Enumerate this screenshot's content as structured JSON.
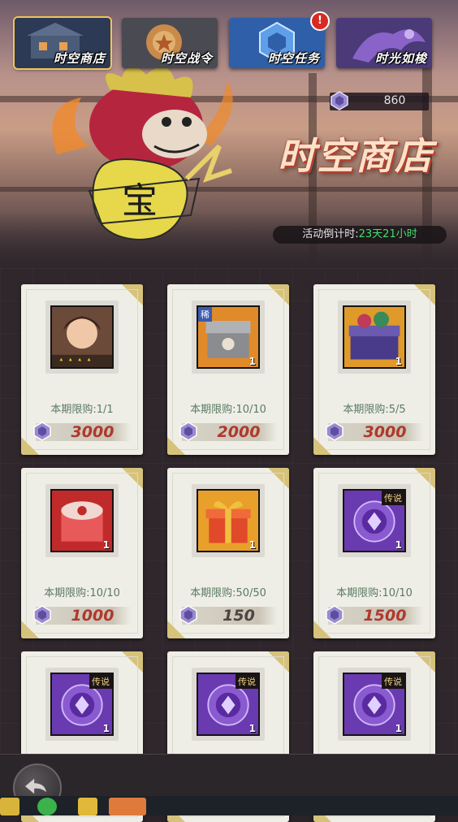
{
  "tabs": [
    {
      "label": "时空商店",
      "active": true
    },
    {
      "label": "时空战令",
      "active": false
    },
    {
      "label": "时空任务",
      "active": false,
      "badge": "!"
    },
    {
      "label": "时光如梭",
      "active": false
    }
  ],
  "currency": {
    "icon": "crystal-gem-icon",
    "value": "860"
  },
  "shop_title": "时空商店",
  "countdown": {
    "label": "活动倒计时:",
    "time": "23天21小时"
  },
  "items": [
    {
      "icon": "hero-portrait-icon",
      "qty": "",
      "tag": "",
      "limit": "本期限购:1/1",
      "price": "3000",
      "price_color": "#b0382c"
    },
    {
      "icon": "rare-chest-icon",
      "qty": "1",
      "tag": "",
      "limit": "本期限购:10/10",
      "price": "2000",
      "price_color": "#b0382c"
    },
    {
      "icon": "treasure-chest-icon",
      "qty": "1",
      "tag": "",
      "limit": "本期限购:5/5",
      "price": "3000",
      "price_color": "#b0382c"
    },
    {
      "icon": "red-box-icon",
      "qty": "1",
      "tag": "",
      "limit": "本期限购:10/10",
      "price": "1000",
      "price_color": "#b0382c"
    },
    {
      "icon": "gift-box-icon",
      "qty": "1",
      "tag": "",
      "limit": "本期限购:50/50",
      "price": "150",
      "price_color": "#4a4640"
    },
    {
      "icon": "legend-emblem-icon",
      "qty": "1",
      "tag": "传说",
      "limit": "本期限购:10/10",
      "price": "1500",
      "price_color": "#b0382c"
    },
    {
      "icon": "legend-emblem-icon",
      "qty": "1",
      "tag": "传说",
      "limit": "",
      "price": "",
      "price_color": "#b0382c"
    },
    {
      "icon": "legend-emblem-icon",
      "qty": "1",
      "tag": "传说",
      "limit": "",
      "price": "",
      "price_color": "#b0382c"
    },
    {
      "icon": "legend-emblem-icon",
      "qty": "1",
      "tag": "传说",
      "limit": "",
      "price": "",
      "price_color": "#b0382c"
    }
  ],
  "rare_tag": "稀",
  "mascot_sign": "宝"
}
